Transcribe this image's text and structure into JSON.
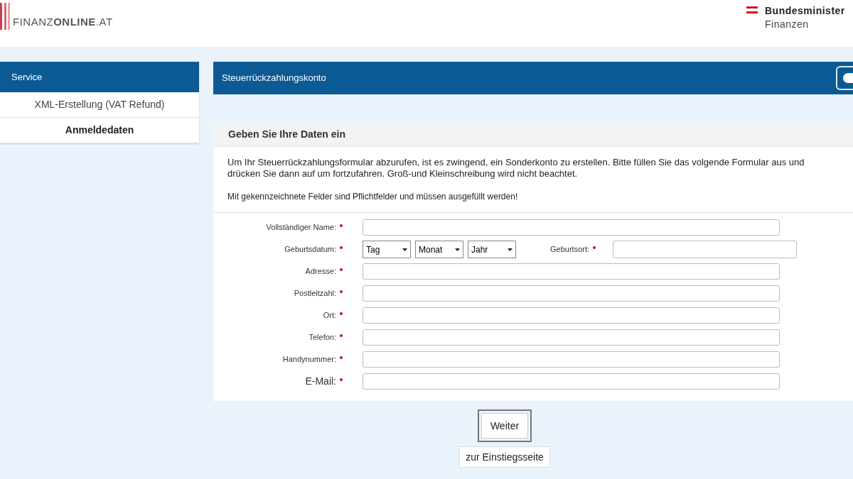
{
  "header": {
    "logo": "FINANZ**ONLINE**.AT",
    "ministry": [
      "Bundesminister",
      "Finanzen"
    ]
  },
  "sidebar": {
    "title": "Service",
    "items": [
      {
        "label": "XML-Erstellung (VAT Refund)",
        "selected": false
      },
      {
        "label": "Anmeldedaten",
        "selected": true
      }
    ]
  },
  "main": {
    "title": "Steuerrückzahlungskonto",
    "card": {
      "title": "Geben Sie Ihre Daten ein",
      "intro": "Um Ihr Steuerrückzahlungsformular abzurufen, ist es zwingend, ein Sonderkonto zu erstellen. Bitte füllen Sie das volgende Formular aus und drücken Sie dann auf um fortzufahren. Groß-und Kleinschreibung wird nicht beachtet.",
      "note": "Mit gekennzeichnete Felder sind Pflichtfelder und müssen ausgefüllt werden!",
      "fields": [
        {
          "kind": "text",
          "label": "Vollständiger Name:",
          "required": true,
          "large": false
        },
        {
          "kind": "date",
          "label": "Geburtsdatum:",
          "required": true,
          "large": false,
          "selects": [
            "Tag",
            "Monat",
            "Jahr"
          ],
          "extra": {
            "label": "Geburtsort:",
            "required": true
          }
        },
        {
          "kind": "text",
          "label": "Adresse:",
          "required": true,
          "large": false
        },
        {
          "kind": "text",
          "label": "Postleitzahl:",
          "required": true,
          "large": false
        },
        {
          "kind": "text",
          "label": "Ort:",
          "required": true,
          "large": false
        },
        {
          "kind": "text",
          "label": "Telefon:",
          "required": true,
          "large": false
        },
        {
          "kind": "text",
          "label": "Handynummer:",
          "required": true,
          "large": false
        },
        {
          "kind": "text",
          "label": "E-Mail:",
          "required": true,
          "large": true
        }
      ]
    },
    "buttons": [
      "Weiter",
      "zur Einstiegsseite"
    ]
  }
}
